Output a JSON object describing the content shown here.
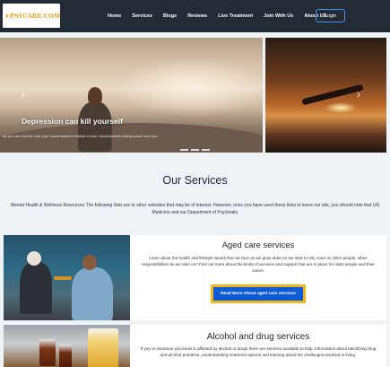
{
  "brand": {
    "logo_text": "PSYCARE.COM",
    "logo_color": "#e6a21a"
  },
  "nav": {
    "links": [
      "Home",
      "Services",
      "Blogs",
      "Reviews",
      "Live Treatment",
      "Join With Us",
      "About US"
    ],
    "login": "Login"
  },
  "hero": {
    "caption": "Depression can kill yourself",
    "subcaption": "as you can recover over your circumstances instead of your circumstances taking power over you.",
    "prev_icon": "‹",
    "next_icon": "›"
  },
  "services": {
    "title": "Our Services",
    "intro": "Mental Health & Wellness Resources The following links are to other websites that may be of interest. However, once you have used these links to leave our site, you should note that UR Medicine and our Department of Psychiatry",
    "cards": [
      {
        "title": "Aged care services",
        "description": "Learn about the health and lifestyle issues that we face as we grow older.As we start to rely more on other people, when responsibilities do we take on? Find out more about the kinds of services and support that are in place for older people and their carers.",
        "button": "Read More About aged care services"
      },
      {
        "title": "Alcohol and drug services",
        "description": "If you or someone you know is affected by alcohol or drugs there are services available to help. Information about identifying drug and alcohol problems, understanding treatment options and learning about the challenges involved in living."
      }
    ]
  },
  "colors": {
    "nav_bg": "#232b35",
    "accent": "#0e5bd8",
    "button_border": "#f2b61c",
    "page_bg": "#eef3f8"
  }
}
